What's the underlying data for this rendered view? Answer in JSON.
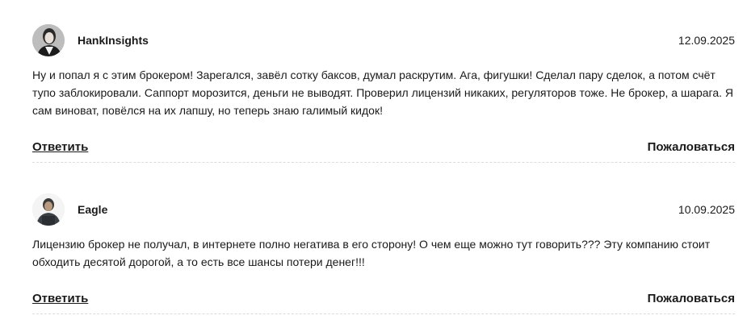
{
  "comments": [
    {
      "author": "HankInsights",
      "date": "12.09.2025",
      "avatar_icon": "user-avatar-photo",
      "text": "Ну и попал я с этим брокером! Зарегался, завёл сотку баксов, думал раскрутим. Ага, фигушки! Сделал пару сделок, а потом счёт тупо заблокировали. Саппорт морозится, деньги не выводят. Проверил лицензий никаких, регуляторов тоже. Не брокер, а шарага. Я сам виноват, повёлся на их лапшу, но теперь знаю галимый кидок!",
      "reply_label": "Ответить",
      "report_label": "Пожаловаться"
    },
    {
      "author": "Eagle",
      "date": "10.09.2025",
      "avatar_icon": "user-avatar-photo",
      "text": "Лицензию брокер не получал, в интернете полно негатива в его сторону! О чем еще можно тут говорить??? Эту компанию стоит обходить десятой дорогой, а то есть все шансы потери денег!!!",
      "reply_label": "Ответить",
      "report_label": "Пожаловаться"
    }
  ],
  "colors": {
    "text": "#1a1a1a",
    "divider": "#dcdcdc",
    "background": "#ffffff"
  }
}
